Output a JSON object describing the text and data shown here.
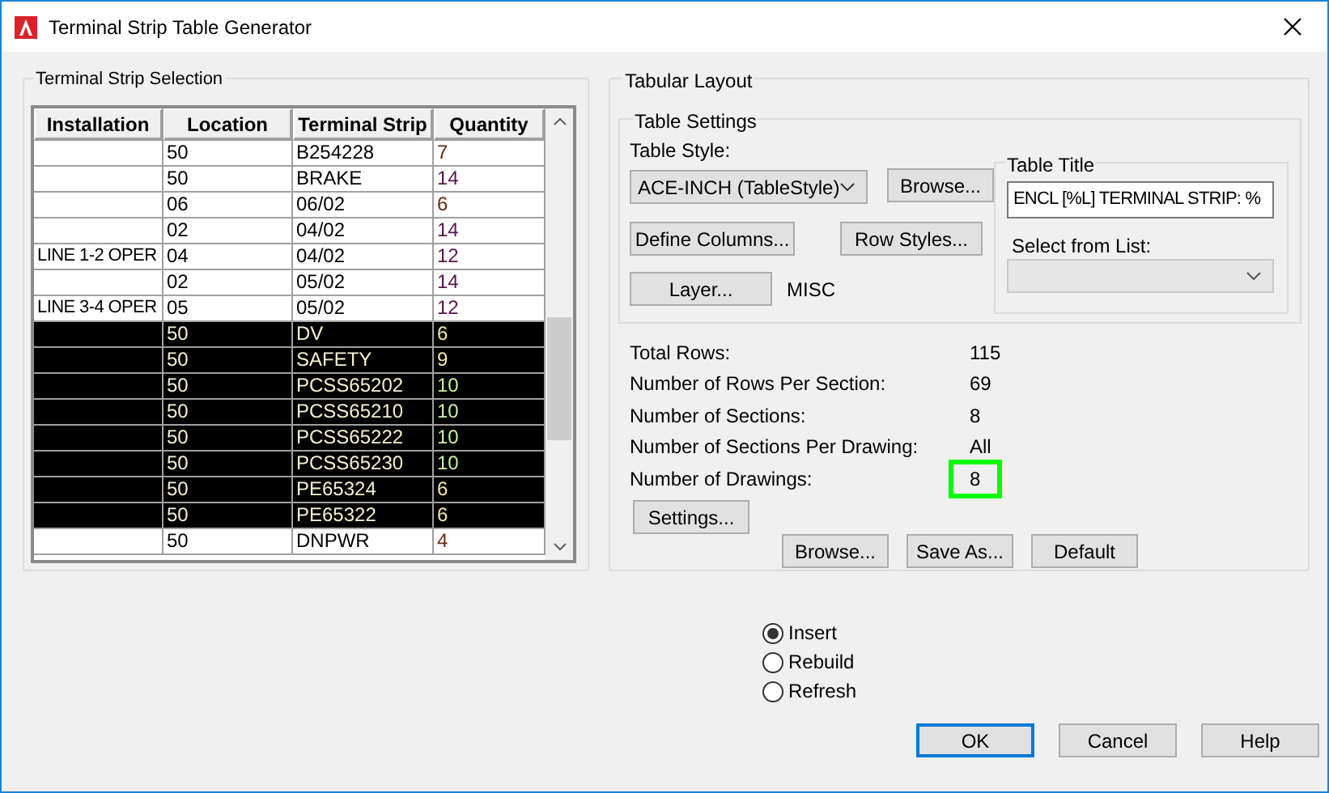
{
  "window": {
    "title": "Terminal Strip Table Generator"
  },
  "selection": {
    "title": "Terminal Strip Selection",
    "columns": [
      "Installation",
      "Location",
      "Terminal Strip",
      "Quantity"
    ],
    "rows": [
      {
        "installation": "",
        "location": "50",
        "strip": "B254228",
        "quantity": "7",
        "selected": false,
        "color": "#6b2a10"
      },
      {
        "installation": "",
        "location": "50",
        "strip": "BRAKE",
        "quantity": "14",
        "selected": false,
        "color": "#5a1050"
      },
      {
        "installation": "",
        "location": "06",
        "strip": "06/02",
        "quantity": "6",
        "selected": false,
        "color": "#6b2a10"
      },
      {
        "installation": "",
        "location": "02",
        "strip": "04/02",
        "quantity": "14",
        "selected": false,
        "color": "#5a1050"
      },
      {
        "installation": "LINE 1-2 OPER",
        "location": "04",
        "strip": "04/02",
        "quantity": "12",
        "selected": false,
        "color": "#5a1050"
      },
      {
        "installation": "",
        "location": "02",
        "strip": "05/02",
        "quantity": "14",
        "selected": false,
        "color": "#5a1050"
      },
      {
        "installation": "LINE 3-4 OPER",
        "location": "05",
        "strip": "05/02",
        "quantity": "12",
        "selected": false,
        "color": "#5a1050"
      },
      {
        "installation": "",
        "location": "50",
        "strip": "DV",
        "quantity": "6",
        "selected": true,
        "color": "#f5e6a0"
      },
      {
        "installation": "",
        "location": "50",
        "strip": "SAFETY",
        "quantity": "9",
        "selected": true,
        "color": "#f5e6a0"
      },
      {
        "installation": "",
        "location": "50",
        "strip": "PCSS65202",
        "quantity": "10",
        "selected": true,
        "color": "#c8f0a0"
      },
      {
        "installation": "",
        "location": "50",
        "strip": "PCSS65210",
        "quantity": "10",
        "selected": true,
        "color": "#c8f0a0"
      },
      {
        "installation": "",
        "location": "50",
        "strip": "PCSS65222",
        "quantity": "10",
        "selected": true,
        "color": "#c8f0a0"
      },
      {
        "installation": "",
        "location": "50",
        "strip": "PCSS65230",
        "quantity": "10",
        "selected": true,
        "color": "#c8f0a0"
      },
      {
        "installation": "",
        "location": "50",
        "strip": "PE65324",
        "quantity": "6",
        "selected": true,
        "color": "#f5e6a0"
      },
      {
        "installation": "",
        "location": "50",
        "strip": "PE65322",
        "quantity": "6",
        "selected": true,
        "color": "#f5e6a0"
      },
      {
        "installation": "",
        "location": "50",
        "strip": "DNPWR",
        "quantity": "4",
        "selected": false,
        "color": "#6b2a10"
      }
    ]
  },
  "layout": {
    "title": "Tabular Layout",
    "settings_title": "Table Settings",
    "style_label": "Table Style:",
    "style_value": "ACE-INCH (TableStyle)",
    "browse": "Browse...",
    "define_columns": "Define Columns...",
    "row_styles": "Row Styles...",
    "layer": "Layer...",
    "layer_value": "MISC",
    "table_title": {
      "title": "Table Title",
      "value": "ENCL [%L] TERMINAL STRIP: %",
      "list_label": "Select from List:"
    },
    "stats": [
      {
        "label": "Total Rows:",
        "value": "115",
        "highlighted": false
      },
      {
        "label": "Number of Rows Per Section:",
        "value": "69",
        "highlighted": false
      },
      {
        "label": "Number of Sections:",
        "value": "8",
        "highlighted": false
      },
      {
        "label": "Number of Sections Per Drawing:",
        "value": "All",
        "highlighted": false
      },
      {
        "label": "Number of Drawings:",
        "value": "8",
        "highlighted": true
      }
    ],
    "settings": "Settings...",
    "bottom_buttons": [
      "Browse...",
      "Save As...",
      "Default"
    ]
  },
  "modes": [
    {
      "label": "Insert",
      "selected": true
    },
    {
      "label": "Rebuild",
      "selected": false
    },
    {
      "label": "Refresh",
      "selected": false
    }
  ],
  "buttons": [
    {
      "label": "OK",
      "default": true
    },
    {
      "label": "Cancel",
      "default": false
    },
    {
      "label": "Help",
      "default": false
    }
  ]
}
